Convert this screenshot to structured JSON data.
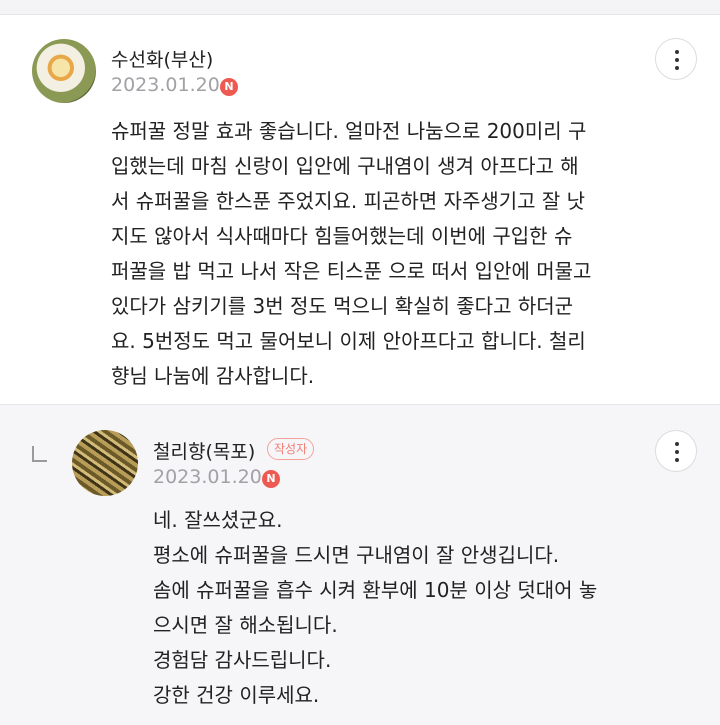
{
  "comments": [
    {
      "author": "수선화(부산)",
      "date": "2023.01.20",
      "new_badge": "N",
      "body": "슈퍼꿀 정말 효과 좋습니다. 얼마전 나눔으로 200미리 구\n입했는데 마침 신랑이 입안에 구내염이 생겨 아프다고 해\n서 슈퍼꿀을 한스푼 주었지요. 피곤하면 자주생기고 잘 낫\n지도 않아서 식사때마다 힘들어했는데 이번에 구입한 슈\n퍼꿀을 밥 먹고 나서 작은 티스푼 으로 떠서 입안에 머물고\n있다가 삼키기를 3번 정도 먹으니 확실히 좋다고 하더군\n요. 5번정도 먹고 물어보니 이제 안아프다고 합니다. 철리\n향님 나눔에 감사합니다."
    },
    {
      "author": "철리향(목포)",
      "author_tag": "작성자",
      "date": "2023.01.20",
      "new_badge": "N",
      "lines": [
        "네. 잘쓰셨군요.",
        "평소에 슈퍼꿀을 드시면 구내염이 잘 안생깁니다.",
        "솜에 슈퍼꿀을 흡수 시켜 환부에 10분 이상 덧대어 놓",
        "으시면 잘 해소됩니다.",
        "경험담 감사드립니다.",
        "강한 건강 이루세요."
      ]
    }
  ],
  "colors": {
    "badge": "#ee5a52",
    "author_tag": "#f07f76",
    "date": "#a1a1a6",
    "reply_bg": "#f6f6f8"
  },
  "icons": {
    "more": "more-vertical-icon",
    "reply": "reply-arrow-icon",
    "new": "new-badge-icon"
  }
}
